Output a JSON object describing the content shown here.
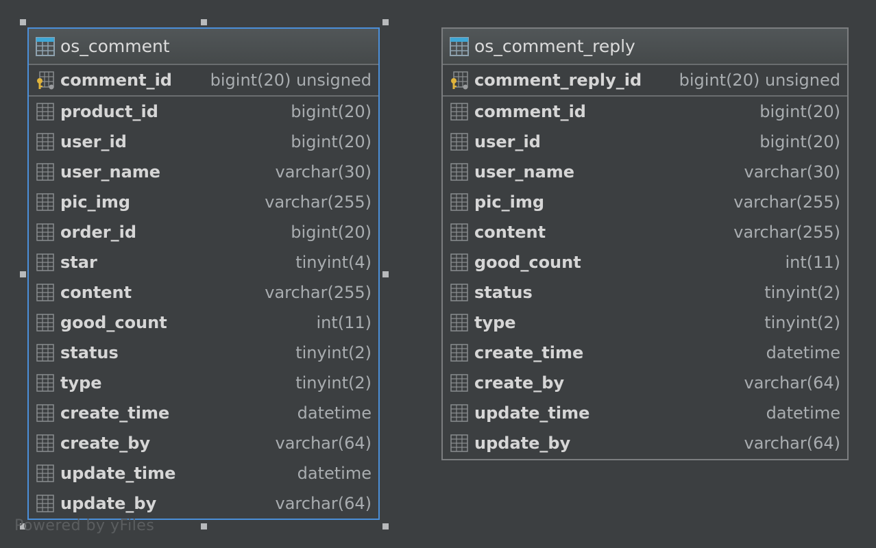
{
  "tables": [
    {
      "name": "os_comment",
      "selected": true,
      "primary_key": {
        "name": "comment_id",
        "type": "bigint(20) unsigned"
      },
      "columns": [
        {
          "name": "product_id",
          "type": "bigint(20)"
        },
        {
          "name": "user_id",
          "type": "bigint(20)"
        },
        {
          "name": "user_name",
          "type": "varchar(30)"
        },
        {
          "name": "pic_img",
          "type": "varchar(255)"
        },
        {
          "name": "order_id",
          "type": "bigint(20)"
        },
        {
          "name": "star",
          "type": "tinyint(4)"
        },
        {
          "name": "content",
          "type": "varchar(255)"
        },
        {
          "name": "good_count",
          "type": "int(11)"
        },
        {
          "name": "status",
          "type": "tinyint(2)"
        },
        {
          "name": "type",
          "type": "tinyint(2)"
        },
        {
          "name": "create_time",
          "type": "datetime"
        },
        {
          "name": "create_by",
          "type": "varchar(64)"
        },
        {
          "name": "update_time",
          "type": "datetime"
        },
        {
          "name": "update_by",
          "type": "varchar(64)"
        }
      ]
    },
    {
      "name": "os_comment_reply",
      "selected": false,
      "primary_key": {
        "name": "comment_reply_id",
        "type": "bigint(20) unsigned"
      },
      "columns": [
        {
          "name": "comment_id",
          "type": "bigint(20)"
        },
        {
          "name": "user_id",
          "type": "bigint(20)"
        },
        {
          "name": "user_name",
          "type": "varchar(30)"
        },
        {
          "name": "pic_img",
          "type": "varchar(255)"
        },
        {
          "name": "content",
          "type": "varchar(255)"
        },
        {
          "name": "good_count",
          "type": "int(11)"
        },
        {
          "name": "status",
          "type": "tinyint(2)"
        },
        {
          "name": "type",
          "type": "tinyint(2)"
        },
        {
          "name": "create_time",
          "type": "datetime"
        },
        {
          "name": "create_by",
          "type": "varchar(64)"
        },
        {
          "name": "update_time",
          "type": "datetime"
        },
        {
          "name": "update_by",
          "type": "varchar(64)"
        }
      ]
    }
  ],
  "watermark": "Powered by yFiles",
  "colors": {
    "background": "#3c3f41",
    "selection": "#4b8fd9",
    "table_icon_header": "#3fa7d6",
    "key_icon": "#e0b43c"
  },
  "icons": {
    "table": "table-icon",
    "column": "column-icon",
    "primary_key": "primary-key-icon"
  }
}
